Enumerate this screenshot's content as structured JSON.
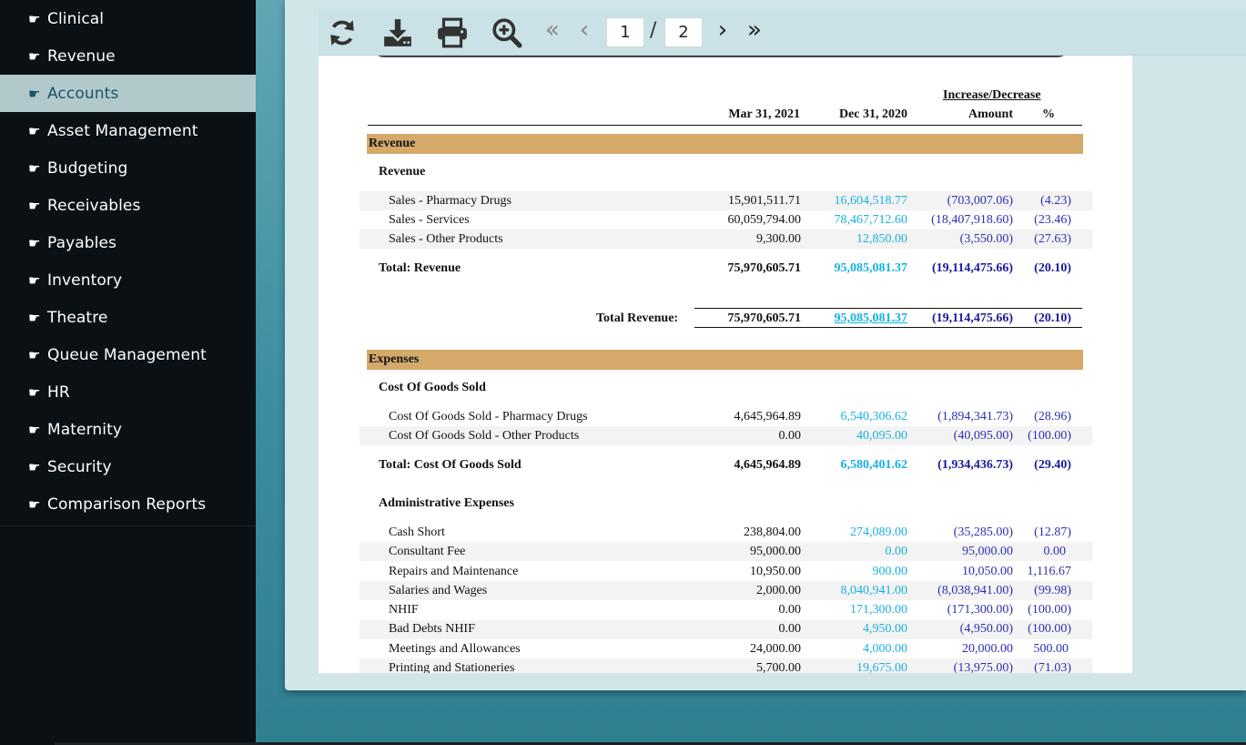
{
  "sidebar": {
    "items": [
      {
        "label": "Clinical",
        "active": false
      },
      {
        "label": "Revenue",
        "active": false
      },
      {
        "label": "Accounts",
        "active": true
      },
      {
        "label": "Asset Management",
        "active": false
      },
      {
        "label": "Budgeting",
        "active": false
      },
      {
        "label": "Receivables",
        "active": false
      },
      {
        "label": "Payables",
        "active": false
      },
      {
        "label": "Inventory",
        "active": false
      },
      {
        "label": "Theatre",
        "active": false
      },
      {
        "label": "Queue Management",
        "active": false
      },
      {
        "label": "HR",
        "active": false
      },
      {
        "label": "Maternity",
        "active": false
      },
      {
        "label": "Security",
        "active": false
      },
      {
        "label": "Comparison Reports",
        "active": false
      }
    ],
    "item_icon": "pointing-hand-icon"
  },
  "toolbar": {
    "icons": [
      "refresh-icon",
      "download-icon",
      "print-icon",
      "zoom-in-icon"
    ],
    "first_page": "«",
    "prev_page": "‹",
    "current_page": "1",
    "separator": "/",
    "total_pages": "2",
    "next_page": "›",
    "last_page": "»"
  },
  "report": {
    "header": {
      "col_mar": "Mar 31, 2021",
      "col_dec": "Dec 31, 2020",
      "inc_dec": "Increase/Decrease",
      "col_amount": "Amount",
      "col_pct": "%"
    },
    "revenue": {
      "band": "Revenue",
      "group": "Revenue",
      "rows": [
        {
          "name": "Sales - Pharmacy Drugs",
          "mar": "15,901,511.71",
          "dec": "16,604,518.77",
          "amt": "(703,007.06)",
          "pct": "(4.23)"
        },
        {
          "name": "Sales - Services",
          "mar": "60,059,794.00",
          "dec": "78,467,712.60",
          "amt": "(18,407,918.60)",
          "pct": "(23.46)"
        },
        {
          "name": "Sales - Other Products",
          "mar": "9,300.00",
          "dec": "12,850.00",
          "amt": "(3,550.00)",
          "pct": "(27.63)"
        }
      ],
      "total": {
        "name": "Total: Revenue",
        "mar": "75,970,605.71",
        "dec": "95,085,081.37",
        "amt": "(19,114,475.66)",
        "pct": "(20.10)"
      },
      "grand_total": {
        "name": "Total Revenue:",
        "mar": "75,970,605.71",
        "dec": "95,085,081.37",
        "amt": "(19,114,475.66)",
        "pct": "(20.10)"
      }
    },
    "expenses": {
      "band": "Expenses",
      "cogs": {
        "group": "Cost Of Goods Sold",
        "rows": [
          {
            "name": "Cost Of Goods Sold - Pharmacy Drugs",
            "mar": "4,645,964.89",
            "dec": "6,540,306.62",
            "amt": "(1,894,341.73)",
            "pct": "(28.96)"
          },
          {
            "name": "Cost Of Goods Sold - Other Products",
            "mar": "0.00",
            "dec": "40,095.00",
            "amt": "(40,095.00)",
            "pct": "(100.00)"
          }
        ],
        "total": {
          "name": "Total: Cost Of Goods Sold",
          "mar": "4,645,964.89",
          "dec": "6,580,401.62",
          "amt": "(1,934,436.73)",
          "pct": "(29.40)"
        }
      },
      "admin": {
        "group": "Administrative Expenses",
        "rows": [
          {
            "name": "Cash Short",
            "mar": "238,804.00",
            "dec": "274,089.00",
            "amt": "(35,285.00)",
            "pct": "(12.87)"
          },
          {
            "name": "Consultant Fee",
            "mar": "95,000.00",
            "dec": "0.00",
            "amt": "95,000.00",
            "pct": "0.00"
          },
          {
            "name": "Repairs and Maintenance",
            "mar": "10,950.00",
            "dec": "900.00",
            "amt": "10,050.00",
            "pct": "1,116.67"
          },
          {
            "name": "Salaries and Wages",
            "mar": "2,000.00",
            "dec": "8,040,941.00",
            "amt": "(8,038,941.00)",
            "pct": "(99.98)"
          },
          {
            "name": "NHIF",
            "mar": "0.00",
            "dec": "171,300.00",
            "amt": "(171,300.00)",
            "pct": "(100.00)"
          },
          {
            "name": "Bad Debts NHIF",
            "mar": "0.00",
            "dec": "4,950.00",
            "amt": "(4,950.00)",
            "pct": "(100.00)"
          },
          {
            "name": "Meetings and Allowances",
            "mar": "24,000.00",
            "dec": "4,000.00",
            "amt": "20,000.00",
            "pct": "500.00"
          },
          {
            "name": "Printing and Stationeries",
            "mar": "5,700.00",
            "dec": "19,675.00",
            "amt": "(13,975.00)",
            "pct": "(71.03)"
          }
        ]
      }
    }
  }
}
